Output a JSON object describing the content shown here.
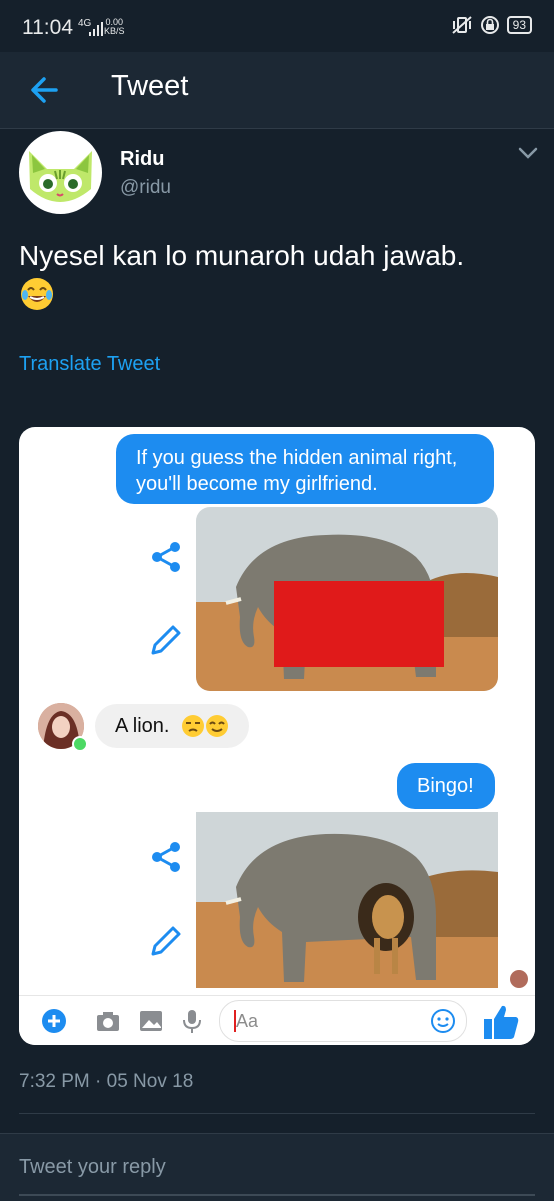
{
  "status_bar": {
    "time": "11:04",
    "network": "4G",
    "speed_value": "0.00",
    "speed_unit": "KB/S",
    "battery": "93"
  },
  "header": {
    "title": "Tweet",
    "back_icon": "arrow-left-icon"
  },
  "tweet": {
    "author_name": "Ridu",
    "author_handle": "@ridu",
    "text": "Nyesel kan lo munaroh udah jawab.",
    "emoji": "face-with-tears-of-joy",
    "translate_label": "Translate Tweet",
    "timestamp": "7:32 PM · 05 Nov 18"
  },
  "chat_image": {
    "message_1_line_1": "If you guess the hidden animal right,",
    "message_1_line_2": "you'll become my girlfriend.",
    "reply": "A lion.",
    "message_2": "Bingo!",
    "composer_placeholder": "Aa",
    "messenger_blue": "#1d8cf0",
    "censor_red": "#e01a1a"
  },
  "reply_bar": {
    "placeholder": "Tweet your reply"
  },
  "colors": {
    "background": "#15202b",
    "accent": "#1da1f2",
    "secondary_text": "#8899a6"
  }
}
